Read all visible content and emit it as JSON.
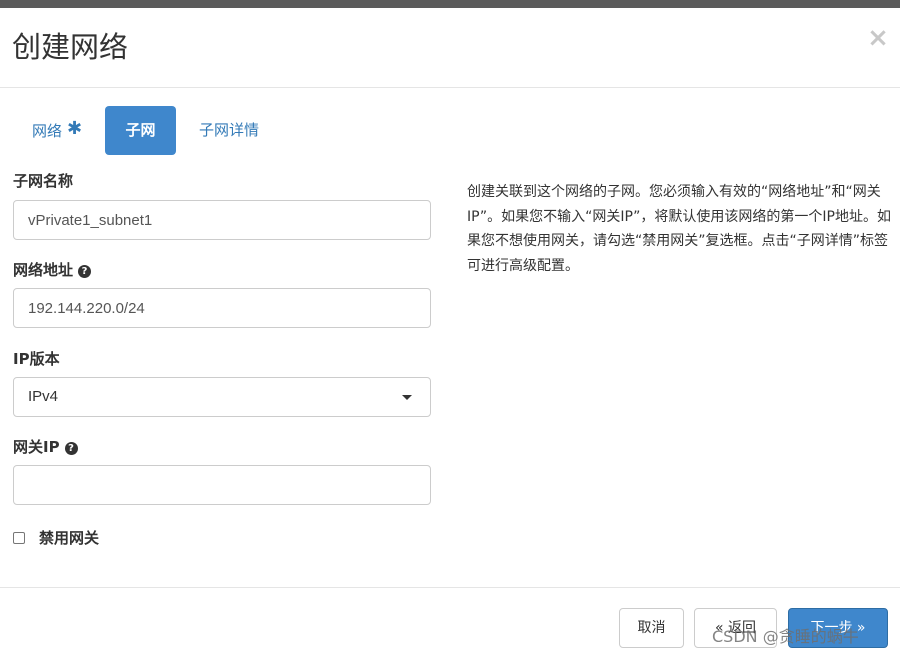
{
  "modal": {
    "title": "创建网络",
    "close_symbol": "×"
  },
  "tabs": [
    {
      "label": "网络",
      "required_mark": "✱",
      "active": false
    },
    {
      "label": "子网",
      "active": true
    },
    {
      "label": "子网详情",
      "active": false
    }
  ],
  "form": {
    "subnet_name": {
      "label": "子网名称",
      "value": "vPrivate1_subnet1"
    },
    "network_address": {
      "label": "网络地址",
      "value": "192.144.220.0/24",
      "help_icon": "question-circle-icon"
    },
    "ip_version": {
      "label": "IP版本",
      "selected": "IPv4"
    },
    "gateway_ip": {
      "label": "网关IP",
      "value": "",
      "help_icon": "question-circle-icon"
    },
    "disable_gateway": {
      "label": "禁用网关",
      "checked": false
    }
  },
  "help_text": "创建关联到这个网络的子网。您必须输入有效的“网络地址”和“网关IP”。如果您不输入“网关IP”，将默认使用该网络的第一个IP地址。如果您不想使用网关，请勾选“禁用网关”复选框。点击“子网详情”标签可进行高级配置。",
  "footer": {
    "cancel_label": "取消",
    "back_label": "« 返回",
    "next_label": "下一步 »"
  },
  "watermark": "CSDN @贪睡的蜗牛",
  "colors": {
    "primary": "#3f87cc",
    "link": "#337ab7",
    "border": "#cccccc"
  }
}
